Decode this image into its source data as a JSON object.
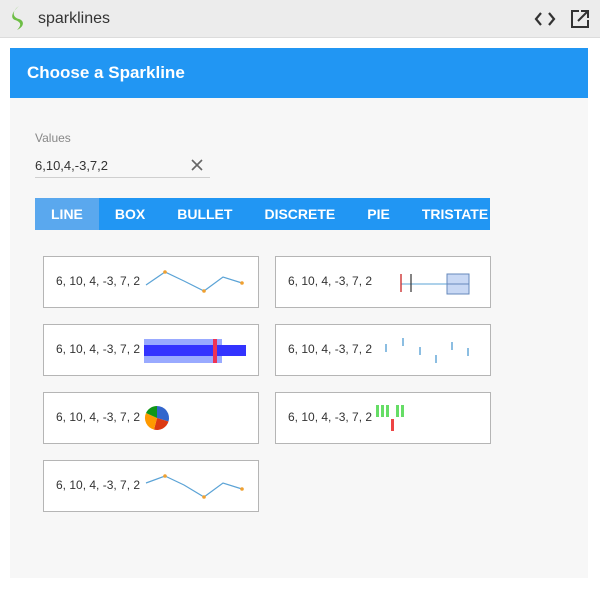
{
  "app": {
    "title": "sparklines"
  },
  "header": {
    "title": "Choose a Sparkline"
  },
  "values": {
    "label": "Values",
    "input_value": "6,10,4,-3,7,2"
  },
  "tabs": [
    {
      "label": "LINE",
      "active": true
    },
    {
      "label": "BOX",
      "active": false
    },
    {
      "label": "BULLET",
      "active": false
    },
    {
      "label": "DISCRETE",
      "active": false
    },
    {
      "label": "PIE",
      "active": false
    },
    {
      "label": "TRISTATE",
      "active": false
    }
  ],
  "cards": [
    {
      "type": "line",
      "label": "6, 10, 4, -3, 7, 2"
    },
    {
      "type": "box",
      "label": "6, 10, 4, -3, 7, 2"
    },
    {
      "type": "bullet",
      "label": "6, 10, 4, -3, 7, 2"
    },
    {
      "type": "discrete",
      "label": "6, 10, 4, -3, 7, 2"
    },
    {
      "type": "pie",
      "label": "6, 10, 4, -3, 7, 2"
    },
    {
      "type": "tristate",
      "label": "6, 10, 4, -3, 7, 2"
    },
    {
      "type": "line",
      "label": "6, 10, 4, -3, 7, 2"
    }
  ],
  "colors": {
    "accent": "#2196f3",
    "tab_active": "#5aa8ee",
    "line": "#5ba3d6",
    "marker": "#f0a030",
    "bullet_range": "#99aaff",
    "bullet_bar": "#3333ff",
    "bullet_target": "#ee3355",
    "pie": [
      "#3366cc",
      "#dc3912",
      "#ff9900",
      "#109618"
    ],
    "tristate_positive": "#66dd66",
    "tristate_negative": "#ee4444"
  },
  "icons": {
    "logo": "sparkline-logo-icon",
    "code": "code-icon",
    "external": "external-link-icon",
    "clear": "close-icon"
  }
}
